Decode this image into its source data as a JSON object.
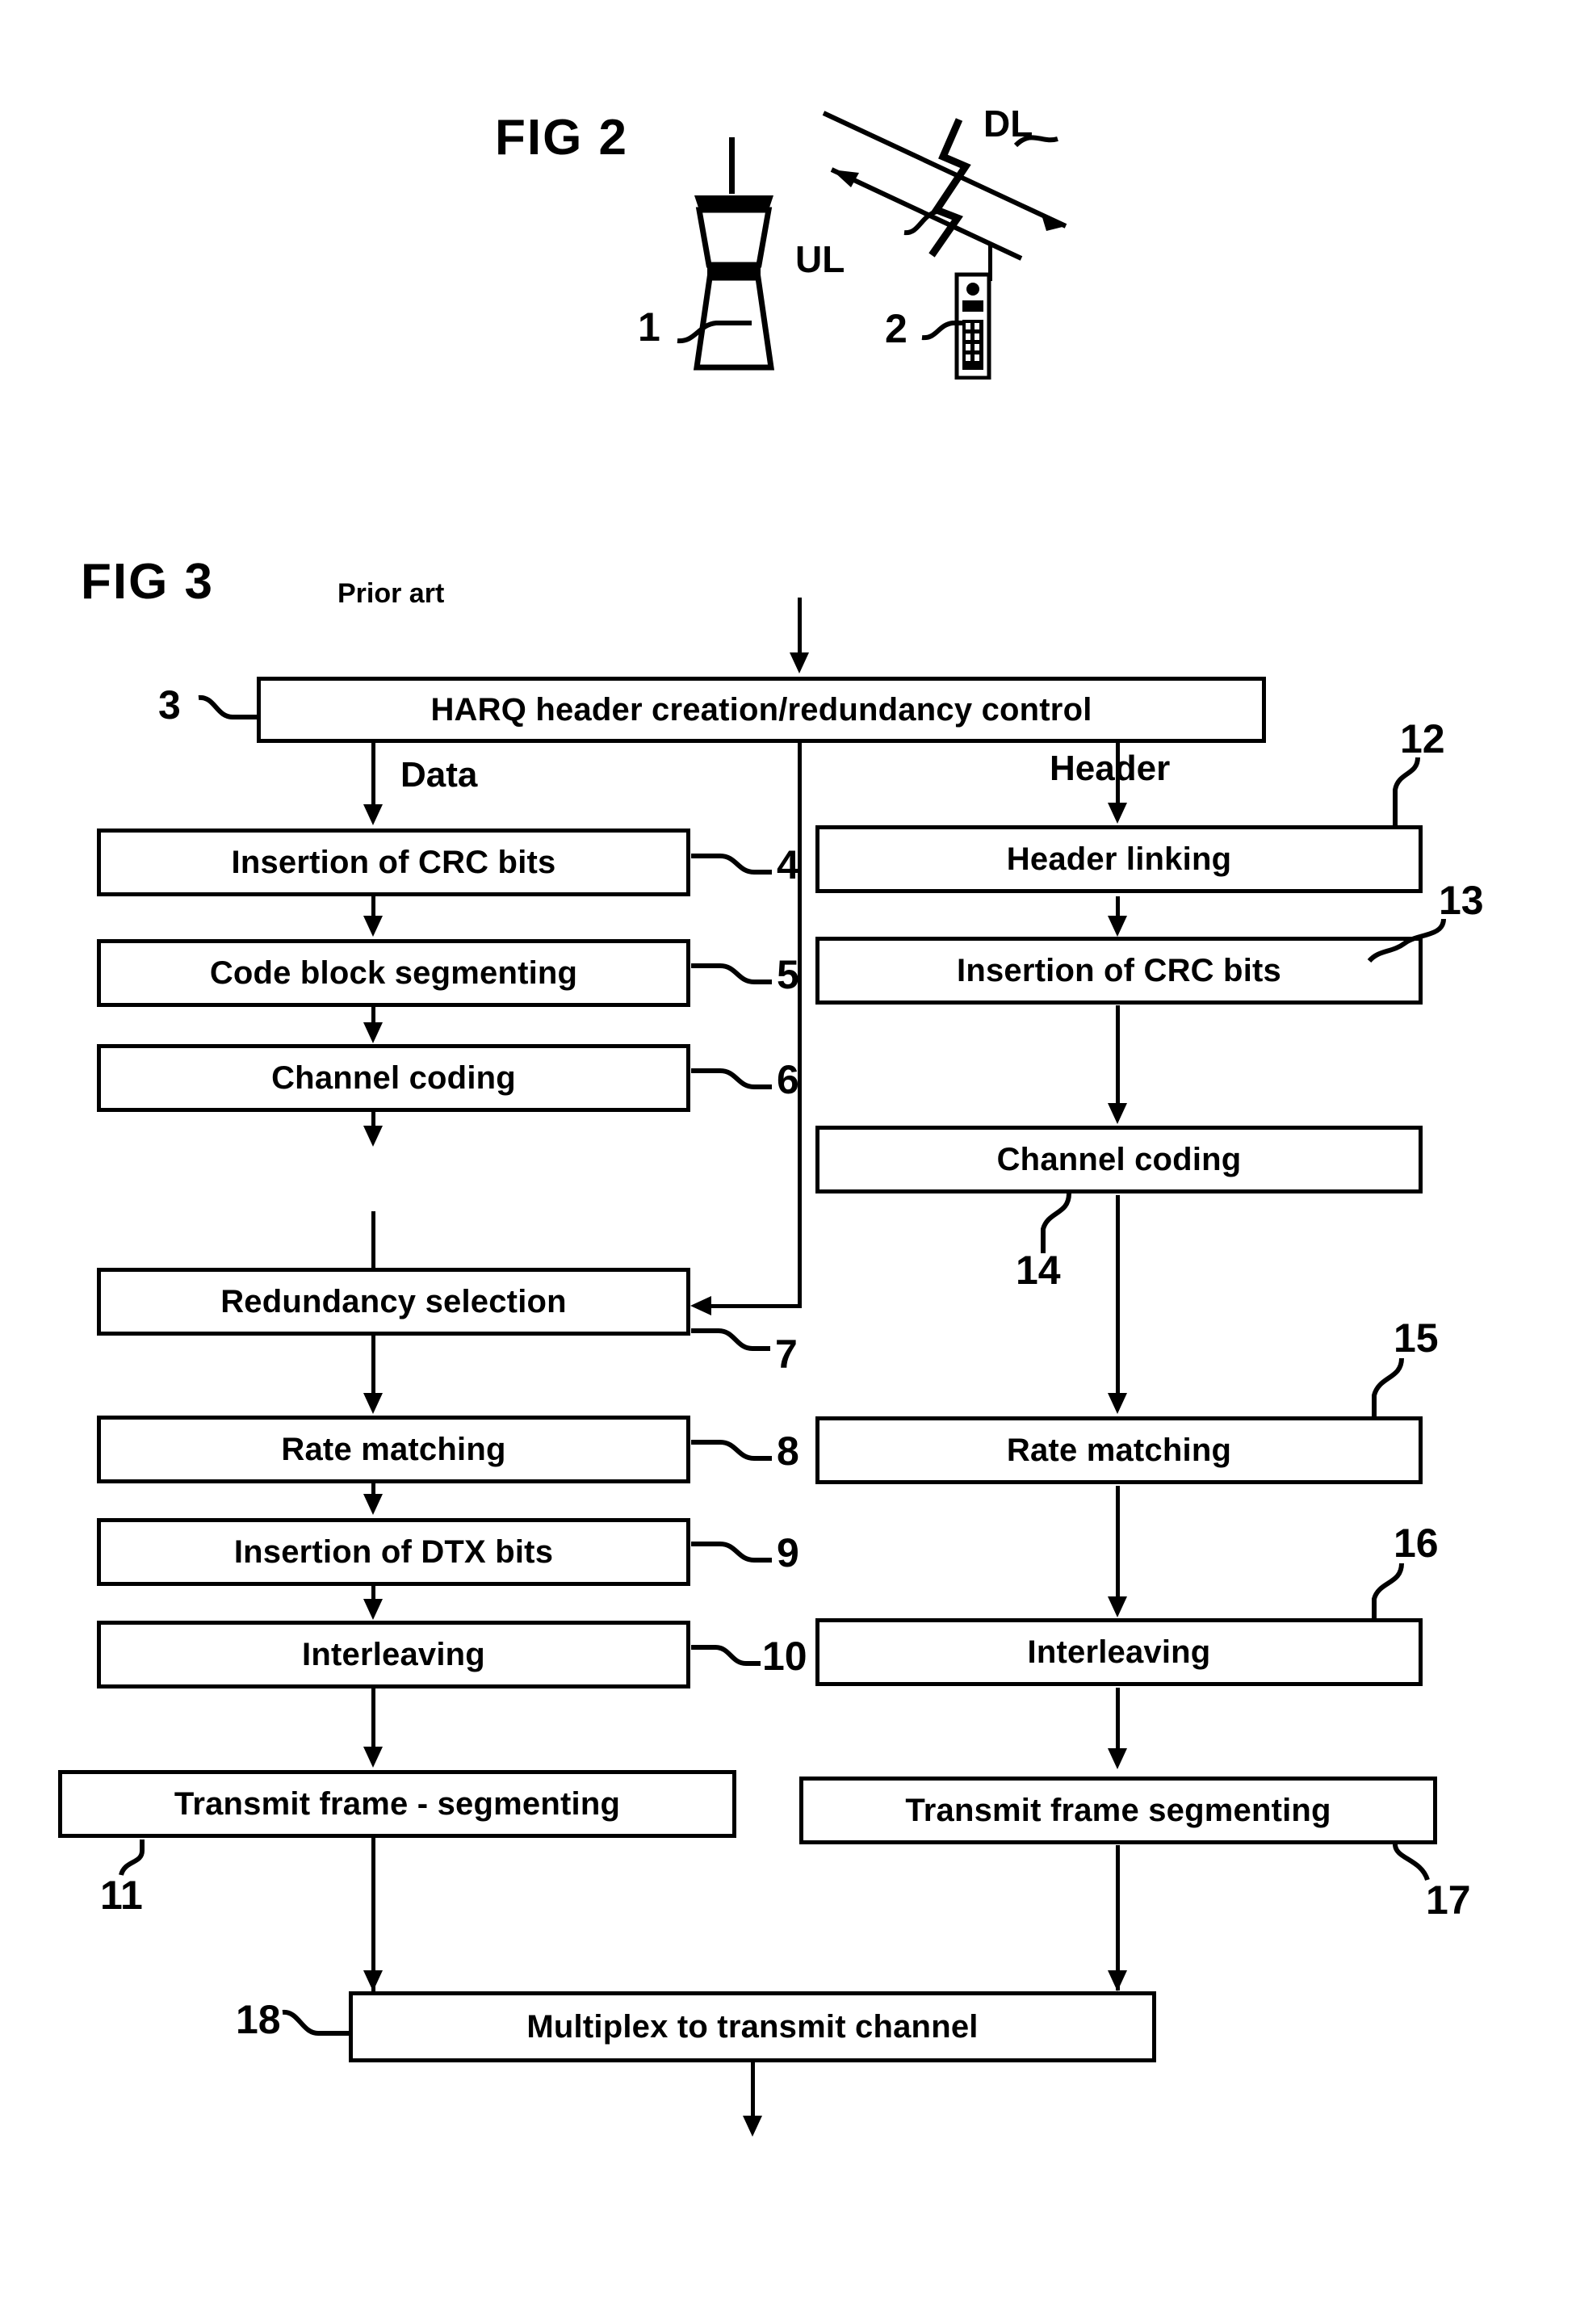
{
  "figures": [
    {
      "id": "fig2",
      "title": "FIG 2",
      "subtitle": "",
      "annotations": {
        "downlink": "DL",
        "uplink": "UL",
        "base_station_ref": "1",
        "mobile_station_ref": "2"
      }
    },
    {
      "id": "fig3",
      "title": "FIG 3",
      "subtitle": "Prior art"
    }
  ],
  "fig3": {
    "branch_labels": {
      "left": "Data",
      "right": "Header"
    },
    "top_box": {
      "label": "HARQ header creation/redundancy control",
      "ref": "3"
    },
    "left_chain": [
      {
        "label": "Insertion of CRC bits",
        "ref": "4"
      },
      {
        "label": "Code block segmenting",
        "ref": "5"
      },
      {
        "label": "Channel coding",
        "ref": "6"
      },
      {
        "label": "Redundancy selection",
        "ref": "7"
      },
      {
        "label": "Rate matching",
        "ref": "8"
      },
      {
        "label": "Insertion of DTX bits",
        "ref": "9"
      },
      {
        "label": "Interleaving",
        "ref": "10"
      },
      {
        "label": "Transmit frame - segmenting",
        "ref": "11"
      }
    ],
    "right_chain": [
      {
        "label": "Header linking",
        "ref": "12"
      },
      {
        "label": "Insertion of CRC bits",
        "ref": "13"
      },
      {
        "label": "Channel coding",
        "ref": "14"
      },
      {
        "label": "Rate matching",
        "ref": "15"
      },
      {
        "label": "Interleaving",
        "ref": "16"
      },
      {
        "label": "Transmit frame segmenting",
        "ref": "17"
      }
    ],
    "bottom_box": {
      "label": "Multiplex to transmit channel",
      "ref": "18"
    }
  },
  "colors": {
    "ink": "#000000",
    "paper": "#ffffff"
  }
}
